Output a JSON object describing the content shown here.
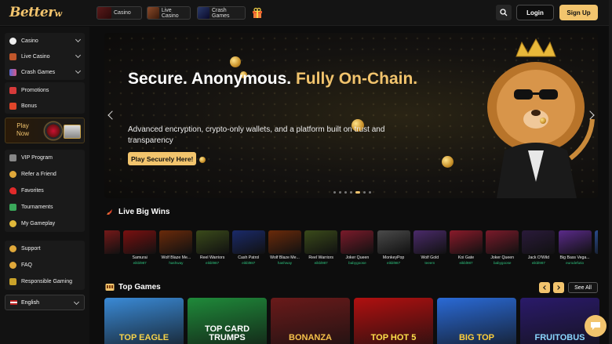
{
  "brand": {
    "logo_main": "Better",
    "logo_suffix": "w",
    "accent": "#f2c46d"
  },
  "topnav": {
    "tabs": [
      {
        "label": "Casino",
        "icon": "roulette-icon"
      },
      {
        "label": "Live Casino",
        "icon": "cards-icon"
      },
      {
        "label": "Crash Games",
        "icon": "plane-icon"
      }
    ],
    "login_label": "Login",
    "signup_label": "Sign Up"
  },
  "sidebar": {
    "main_items": [
      {
        "label": "Casino",
        "icon": "dice-icon"
      },
      {
        "label": "Live Casino",
        "icon": "live-dealer-icon"
      },
      {
        "label": "Crash Games",
        "icon": "rocket-icon"
      }
    ],
    "promo_items": [
      {
        "label": "Promotions",
        "icon": "megaphone-icon"
      },
      {
        "label": "Bonus",
        "icon": "bonus-icon"
      }
    ],
    "play_now_line1": "Play",
    "play_now_line2": "Now",
    "community_items": [
      {
        "label": "VIP Program",
        "icon": "crown-icon"
      },
      {
        "label": "Refer a Friend",
        "icon": "users-icon"
      },
      {
        "label": "Favorites",
        "icon": "heart-icon"
      },
      {
        "label": "Tournaments",
        "icon": "trophy-icon"
      },
      {
        "label": "My Gameplay",
        "icon": "gameplay-icon"
      }
    ],
    "help_items": [
      {
        "label": "Support",
        "icon": "support-icon"
      },
      {
        "label": "FAQ",
        "icon": "faq-icon"
      },
      {
        "label": "Responsible Gaming",
        "icon": "shield-icon"
      }
    ],
    "language": "English"
  },
  "hero": {
    "title_white": "Secure. Anonymous.",
    "title_gold": "Fully On-Chain.",
    "subtitle": "Advanced encryption, crypto-only wallets, and a platform built on trust and transparency",
    "cta": "Play Securely Here!",
    "slide_count": 7,
    "active_slide": 4
  },
  "live_wins": {
    "title": "Live Big Wins",
    "items": [
      {
        "game": "",
        "user": "",
        "color": "#8a1a1a"
      },
      {
        "game": "Samurai",
        "user": "eikbl987",
        "color": "#7a1010"
      },
      {
        "game": "Wolf Blaze Me...",
        "user": "hashway",
        "color": "#6a2a0a"
      },
      {
        "game": "Reel Warriors",
        "user": "eikbl987",
        "color": "#3a4a1a"
      },
      {
        "game": "Cash Patrol",
        "user": "eikbl987",
        "color": "#1a2a6a"
      },
      {
        "game": "Wolf Blaze Me...",
        "user": "hashway",
        "color": "#6a2a0a"
      },
      {
        "game": "Reel Warriors",
        "user": "eikbl987",
        "color": "#3a4a1a"
      },
      {
        "game": "Joker Queen",
        "user": "babygoose",
        "color": "#7a1a2a"
      },
      {
        "game": "MonkeyPop",
        "user": "eikbl987",
        "color": "#4a4a4a"
      },
      {
        "game": "Wolf Gold",
        "user": "teeem",
        "color": "#4a2a6a"
      },
      {
        "game": "Koi Gate",
        "user": "eikbl987",
        "color": "#8a1a2a"
      },
      {
        "game": "Joker Queen",
        "user": "babygoose",
        "color": "#7a1a2a"
      },
      {
        "game": "Jack O'Wild",
        "user": "eikbl987",
        "color": "#2a1a3a"
      },
      {
        "game": "Big Bass Vega...",
        "user": "eurodefutio",
        "color": "#5a2a8a"
      },
      {
        "game": "",
        "user": "",
        "color": "#2a4a8a"
      }
    ]
  },
  "top_games": {
    "title": "Top Games",
    "see_all": "See All",
    "items": [
      {
        "title": "TOP EAGLE",
        "bg": "#3a8ad6",
        "fg": "#f6d34a"
      },
      {
        "title": "TOP CARD TRUMPS",
        "bg": "#1f8a3a",
        "fg": "#ffffff"
      },
      {
        "title": "BONANZA",
        "bg": "#6a1a1a",
        "fg": "#f6c04a"
      },
      {
        "title": "TOP HOT 5",
        "bg": "#b01010",
        "fg": "#ffe04a"
      },
      {
        "title": "BIG TOP",
        "bg": "#2a6ad6",
        "fg": "#ffcf3a"
      },
      {
        "title": "FRUITOBUS",
        "bg": "#2a1a6a",
        "fg": "#8ad6ff"
      }
    ]
  }
}
